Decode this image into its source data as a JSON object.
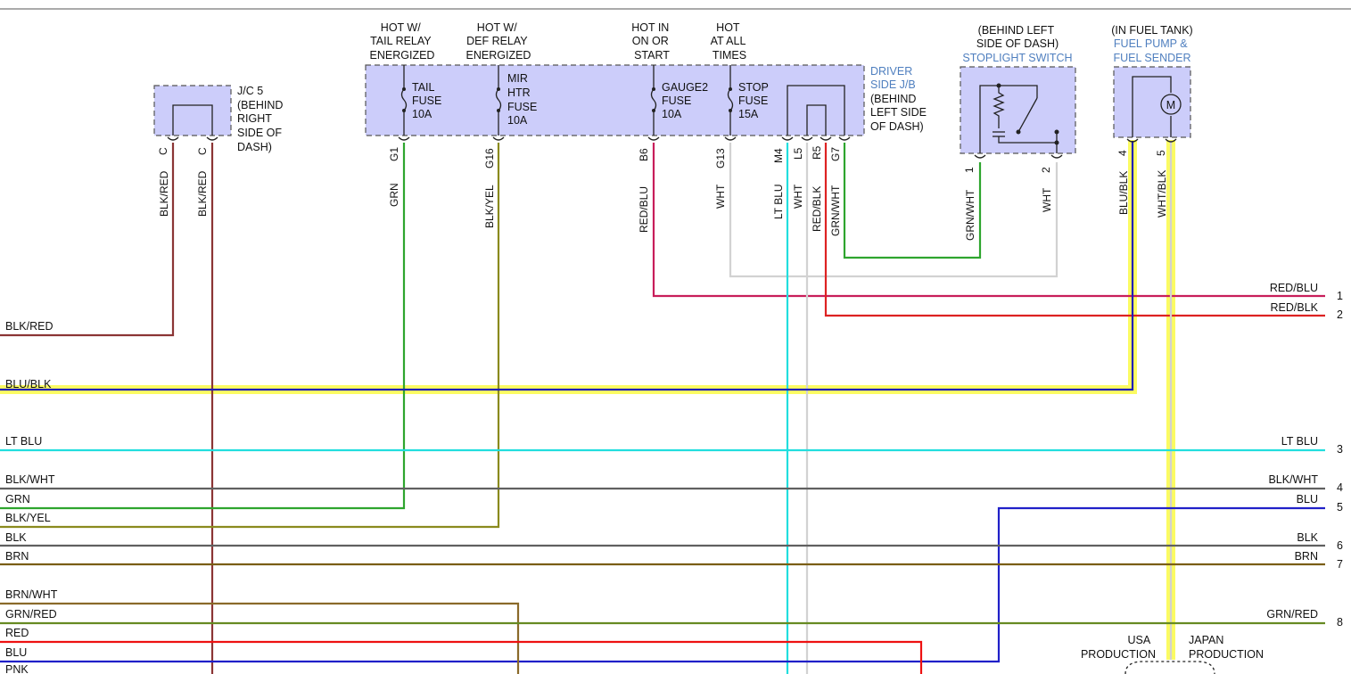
{
  "colors": {
    "box_fill": "#cccdfa",
    "highlight": "#fbfb62",
    "label_blue": "#4f7fbf"
  },
  "jc5": {
    "title": [
      "J/C 5",
      "(BEHIND",
      "RIGHT",
      "SIDE OF",
      "DASH)"
    ],
    "pins": [
      "C",
      "C"
    ],
    "wires": [
      "BLK/RED",
      "BLK/RED"
    ]
  },
  "jb": {
    "headers": {
      "tail": [
        "HOT W/",
        "TAIL RELAY",
        "ENERGIZED"
      ],
      "def": [
        "HOT W/",
        "DEF RELAY",
        "ENERGIZED"
      ],
      "gauge": [
        "HOT IN",
        "ON OR",
        "START"
      ],
      "stop": [
        "HOT",
        "AT ALL",
        "TIMES"
      ]
    },
    "fuses": {
      "tail": [
        "TAIL",
        "FUSE",
        "10A"
      ],
      "mir": [
        "MIR",
        "HTR",
        "FUSE",
        "10A"
      ],
      "gauge": [
        "GAUGE2",
        "FUSE",
        "10A"
      ],
      "stop": [
        "STOP",
        "FUSE",
        "15A"
      ]
    },
    "title": [
      "DRIVER",
      "SIDE J/B"
    ],
    "location": [
      "(BEHIND",
      "LEFT SIDE",
      "OF DASH)"
    ],
    "pins": [
      "G1",
      "G16",
      "B6",
      "G13",
      "M4",
      "L5",
      "R5",
      "G7"
    ],
    "wires": [
      "GRN",
      "BLK/YEL",
      "RED/BLU",
      "WHT",
      "LT BLU",
      "WHT",
      "RED/BLK",
      "GRN/WHT"
    ]
  },
  "stoplight": {
    "location": [
      "(BEHIND LEFT",
      "SIDE OF DASH)"
    ],
    "title": "STOPLIGHT SWITCH",
    "pins": [
      "1",
      "2"
    ],
    "wires": [
      "GRN/WHT",
      "WHT"
    ]
  },
  "fuelpump": {
    "location": "(IN FUEL TANK)",
    "title": [
      "FUEL PUMP &",
      "FUEL SENDER"
    ],
    "motor_symbol": "M",
    "pins": [
      "4",
      "5"
    ],
    "wires": [
      "BLU/BLK",
      "WHT/BLK"
    ]
  },
  "left_labels": [
    "BLK/RED",
    "BLU/BLK",
    "LT BLU",
    "BLK/WHT",
    "GRN",
    "BLK/YEL",
    "BLK",
    "BRN",
    "BRN/WHT",
    "GRN/RED",
    "RED",
    "BLU",
    "PNK"
  ],
  "right_labels": [
    "RED/BLU",
    "RED/BLK",
    "LT BLU",
    "BLK/WHT",
    "BLU",
    "BLK",
    "BRN",
    "GRN/RED"
  ],
  "right_numbers": [
    "1",
    "2",
    "3",
    "4",
    "5",
    "6",
    "7",
    "8"
  ],
  "production": {
    "usa": [
      "USA",
      "PRODUCTION"
    ],
    "japan": [
      "JAPAN",
      "PRODUCTION"
    ]
  }
}
